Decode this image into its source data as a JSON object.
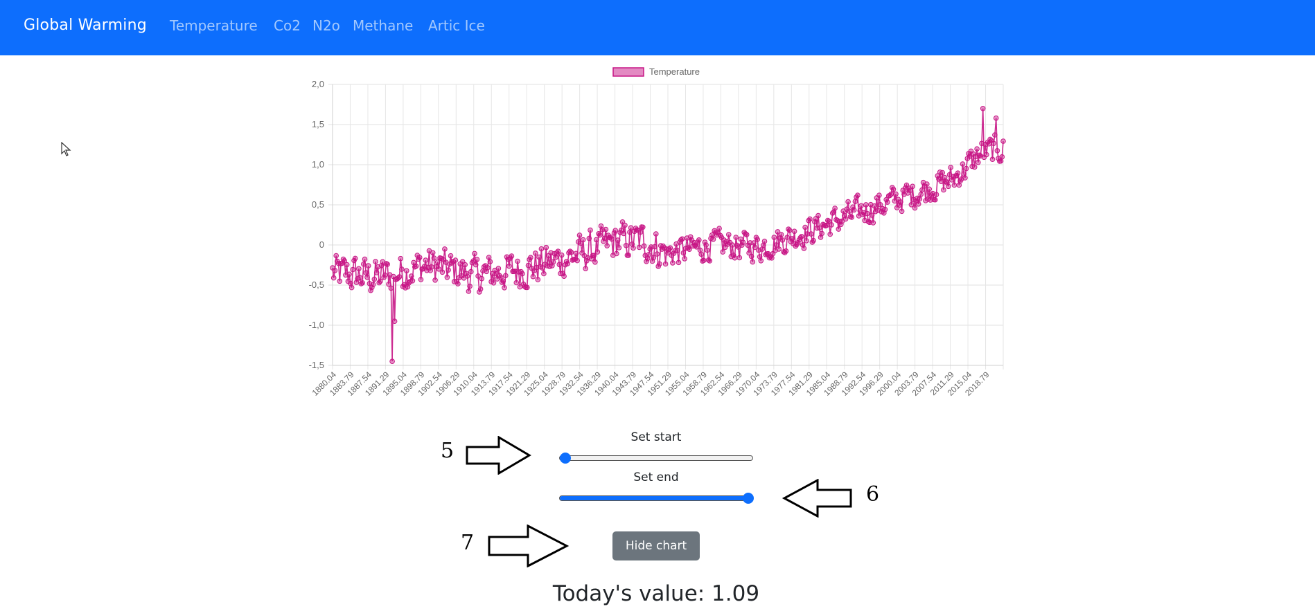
{
  "navbar": {
    "brand": "Global Warming",
    "links": [
      "Temperature",
      "Co2",
      "N2o",
      "Methane",
      "Artic Ice"
    ],
    "background": "#0d6efd"
  },
  "chart_data": {
    "type": "line",
    "legend": "Temperature",
    "legend_position": "top-center",
    "series_color": "#c71585",
    "grid": true,
    "ylim": [
      -1.5,
      2.0
    ],
    "y_ticks": [
      "2,0",
      "1,5",
      "1,0",
      "0,5",
      "0",
      "-0,5",
      "-1,0",
      "-1,5"
    ],
    "x_tick_labels": [
      "1880.04",
      "1883.79",
      "1887.54",
      "1891.29",
      "1895.04",
      "1898.79",
      "1902.54",
      "1906.29",
      "1910.04",
      "1913.79",
      "1917.54",
      "1921.29",
      "1925.04",
      "1928.79",
      "1932.54",
      "1936.29",
      "1940.04",
      "1943.79",
      "1947.54",
      "1951.29",
      "1955.04",
      "1958.79",
      "1962.54",
      "1966.29",
      "1970.04",
      "1973.79",
      "1977.54",
      "1981.29",
      "1985.04",
      "1988.79",
      "1992.54",
      "1996.29",
      "2000.04",
      "2003.79",
      "2007.54",
      "2011.29",
      "2015.04",
      "2018.79"
    ],
    "xlim": [
      1880.04,
      2020.54
    ],
    "trend_anchors": [
      [
        1880,
        -0.35
      ],
      [
        1890,
        -0.4
      ],
      [
        1900,
        -0.25
      ],
      [
        1910,
        -0.38
      ],
      [
        1920,
        -0.3
      ],
      [
        1930,
        -0.15
      ],
      [
        1940,
        0.05
      ],
      [
        1945,
        0.05
      ],
      [
        1950,
        -0.1
      ],
      [
        1960,
        0.0
      ],
      [
        1970,
        -0.02
      ],
      [
        1980,
        0.18
      ],
      [
        1990,
        0.4
      ],
      [
        2000,
        0.6
      ],
      [
        2010,
        0.82
      ],
      [
        2016,
        1.15
      ],
      [
        2020.5,
        1.2
      ]
    ],
    "notable_points": [
      [
        1892.5,
        -1.45
      ],
      [
        2016.2,
        1.7
      ],
      [
        1893.0,
        -0.95
      ],
      [
        2019.0,
        1.58
      ]
    ]
  },
  "controls": {
    "start_label": "Set start",
    "end_label": "Set end",
    "start_value": 0,
    "end_value": 100,
    "hide_button": "Hide chart"
  },
  "today": {
    "text": "Today's value: 1.09"
  },
  "annotations": {
    "arrow_5": "5",
    "arrow_6": "6",
    "arrow_7": "7"
  }
}
